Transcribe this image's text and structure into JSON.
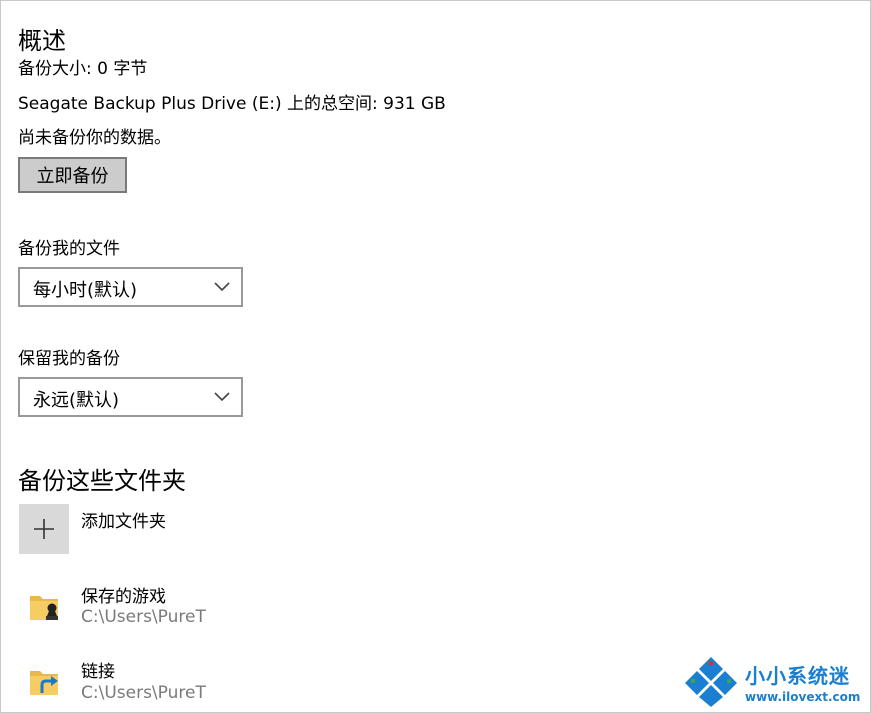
{
  "overview": {
    "title": "概述",
    "backup_size": "备份大小: 0 字节",
    "total_space": "Seagate Backup Plus Drive (E:) 上的总空间: 931 GB",
    "status": "尚未备份你的数据。",
    "backup_now_label": "立即备份"
  },
  "backup_files": {
    "label": "备份我的文件",
    "selected": "每小时(默认)"
  },
  "keep_backups": {
    "label": "保留我的备份",
    "selected": "永远(默认)"
  },
  "folders": {
    "title": "备份这些文件夹",
    "add_label": "添加文件夹",
    "items": [
      {
        "name": "保存的游戏",
        "path": "C:\\Users\\PureT",
        "icon": "saved-games-folder-icon"
      },
      {
        "name": "链接",
        "path": "C:\\Users\\PureT",
        "icon": "links-folder-icon"
      }
    ]
  },
  "watermark": {
    "name": "小小系统迷",
    "url": "www.ilovext.com"
  },
  "colors": {
    "button_bg": "#cccccc",
    "watermark_blue": "#1a7fd1",
    "muted_text": "#7a7a7a"
  }
}
